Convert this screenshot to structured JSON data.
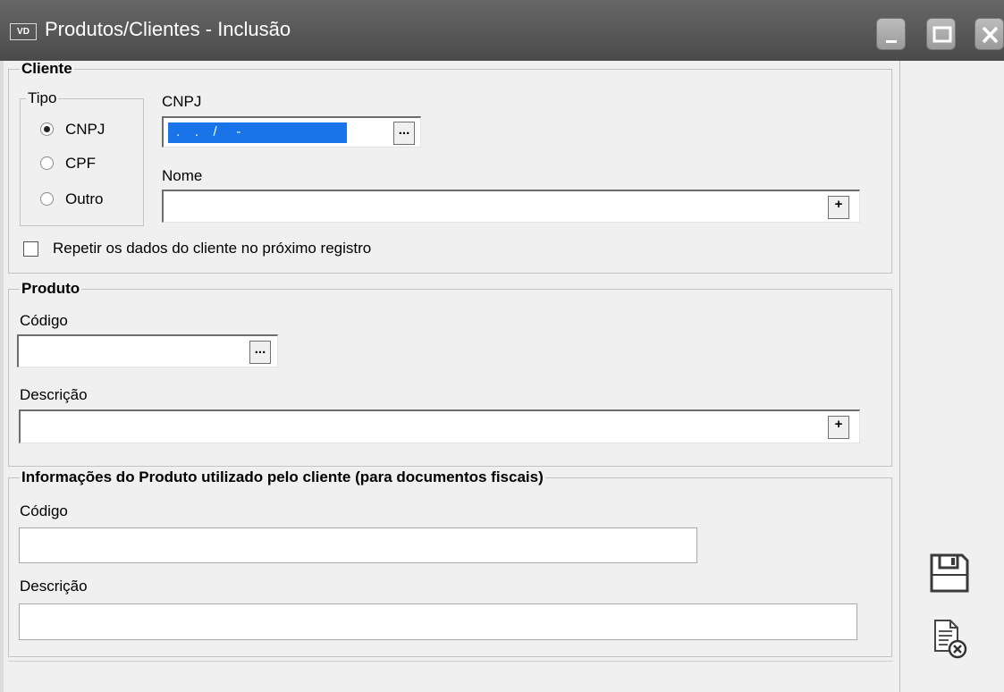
{
  "window": {
    "app_badge": "VD",
    "title": "Produtos/Clientes - Inclusão"
  },
  "cliente": {
    "legend": "Cliente",
    "tipo": {
      "legend": "Tipo",
      "options": [
        {
          "label": "CNPJ",
          "selected": true
        },
        {
          "label": "CPF",
          "selected": false
        },
        {
          "label": "Outro",
          "selected": false
        }
      ]
    },
    "cnpj_label": "CNPJ",
    "cnpj_value": " .   .   /    -  ",
    "lookup_button": "...",
    "nome_label": "Nome",
    "nome_value": "",
    "add_button": "+",
    "repeat_checkbox_label": "Repetir os dados do cliente no próximo registro",
    "repeat_checked": false
  },
  "produto": {
    "legend": "Produto",
    "codigo_label": "Código",
    "codigo_value": "",
    "lookup_button": "...",
    "descricao_label": "Descrição",
    "descricao_value": "",
    "add_button": "+"
  },
  "info_produto_cliente": {
    "legend": "Informações do Produto utilizado pelo cliente (para documentos fiscais)",
    "codigo_label": "Código",
    "codigo_value": "",
    "descricao_label": "Descrição",
    "descricao_value": ""
  },
  "side_actions": {
    "save_icon": "floppy-disk-icon",
    "cancel_icon": "document-cancel-icon"
  }
}
